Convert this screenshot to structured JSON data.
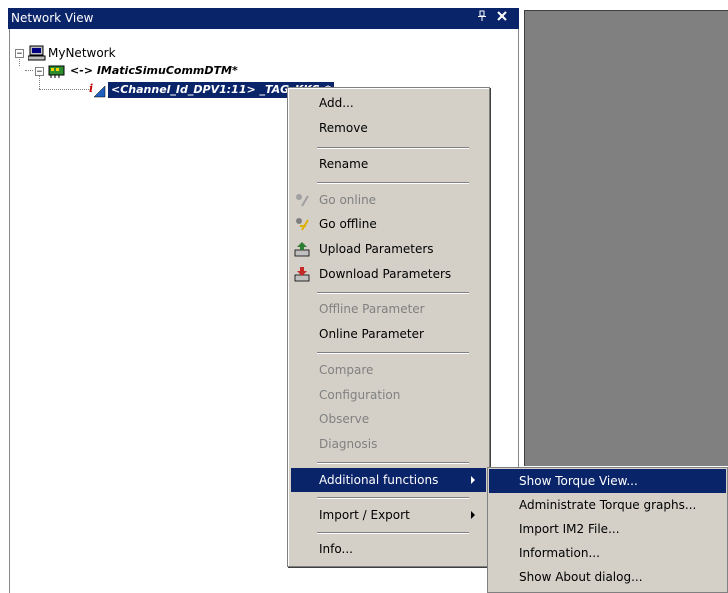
{
  "window": {
    "title": "Network View",
    "pin_glyph": "📌",
    "close_glyph": "✕"
  },
  "tree": {
    "root": {
      "label": "MyNetwork",
      "icon": "network-pc-icon",
      "expander": "−"
    },
    "child": {
      "label": "<-> IMaticSimuCommDTM*",
      "icon": "network-card-icon",
      "expander": "−"
    },
    "device": {
      "label": "<Channel_Id_DPV1:11> _TAG_KKS_*",
      "icon": "device-info-icon"
    }
  },
  "context_menu": {
    "items": [
      {
        "label": "Add...",
        "disabled": true
      },
      {
        "label": "Remove",
        "disabled": false
      },
      {
        "label": "Rename",
        "disabled": false
      },
      {
        "label": "Go online",
        "disabled": true,
        "icon": "go-online-icon"
      },
      {
        "label": "Go offline",
        "disabled": false,
        "icon": "go-offline-icon"
      },
      {
        "label": "Upload Parameters",
        "disabled": false,
        "icon": "upload-icon"
      },
      {
        "label": "Download Parameters",
        "disabled": false,
        "icon": "download-icon"
      },
      {
        "label": "Offline Parameter",
        "disabled": true
      },
      {
        "label": "Online Parameter",
        "disabled": false
      },
      {
        "label": "Compare",
        "disabled": true
      },
      {
        "label": "Configuration",
        "disabled": true
      },
      {
        "label": "Observe",
        "disabled": true
      },
      {
        "label": "Diagnosis",
        "disabled": true
      },
      {
        "label": "Additional functions",
        "disabled": false,
        "highlighted": true,
        "submenu": true
      },
      {
        "label": "Import / Export",
        "disabled": false,
        "submenu": true
      },
      {
        "label": "Info...",
        "disabled": false
      }
    ]
  },
  "submenu": {
    "items": [
      {
        "label": "Show Torque View...",
        "highlighted": true
      },
      {
        "label": "Administrate Torque graphs..."
      },
      {
        "label": "Import IM2 File..."
      },
      {
        "label": "Information..."
      },
      {
        "label": "Show About dialog..."
      }
    ]
  },
  "colors": {
    "titlebar": "#0a246a",
    "menu_bg": "#d4d0c8",
    "highlight": "#0a246a",
    "panel_grey": "#808080"
  }
}
